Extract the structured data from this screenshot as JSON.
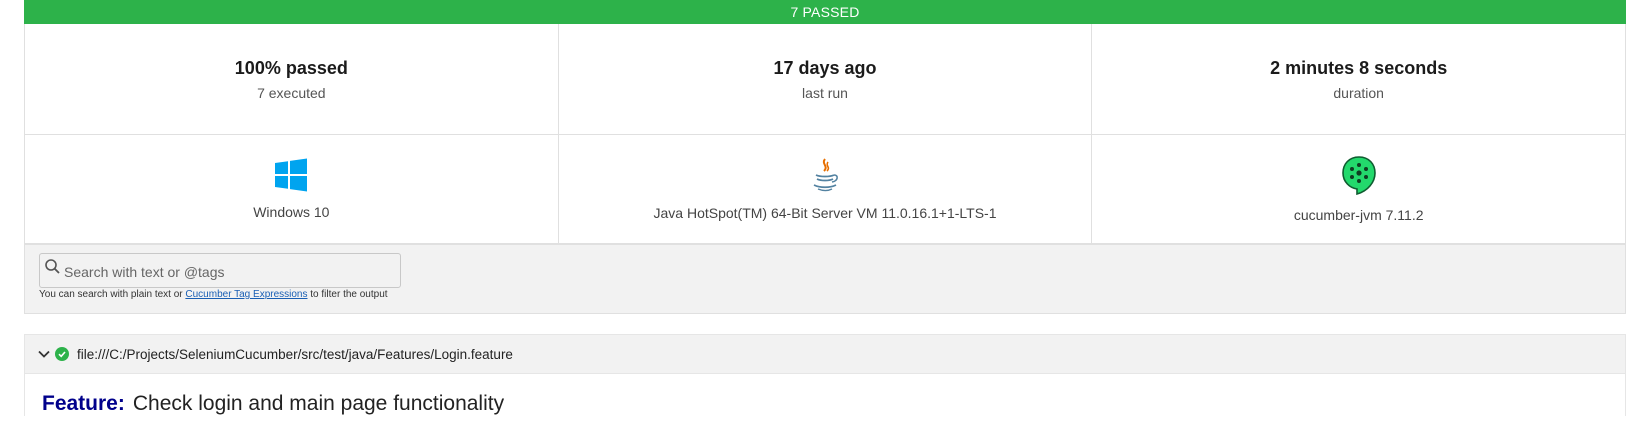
{
  "banner": {
    "text": "7 PASSED",
    "color": "#2db24a"
  },
  "summary": [
    {
      "value": "100% passed",
      "label": "7 executed"
    },
    {
      "value": "17 days ago",
      "label": "last run"
    },
    {
      "value": "2 minutes 8 seconds",
      "label": "duration"
    }
  ],
  "environment": [
    {
      "icon": "windows-icon",
      "label": "Windows 10"
    },
    {
      "icon": "java-icon",
      "label": "Java HotSpot(TM) 64-Bit Server VM 11.0.16.1+1-LTS-1"
    },
    {
      "icon": "cucumber-icon",
      "label": "cucumber-jvm 7.11.2"
    }
  ],
  "search": {
    "placeholder": "Search with text or @tags",
    "value": "",
    "help_prefix": "You can search with plain text or",
    "help_link": "Cucumber Tag Expressions",
    "help_suffix": "to filter the output"
  },
  "feature": {
    "path": "file:///C:/Projects/SeleniumCucumber/src/test/java/Features/Login.feature",
    "status": "passed",
    "keyword": "Feature:",
    "name": "Check login and main page functionality"
  }
}
